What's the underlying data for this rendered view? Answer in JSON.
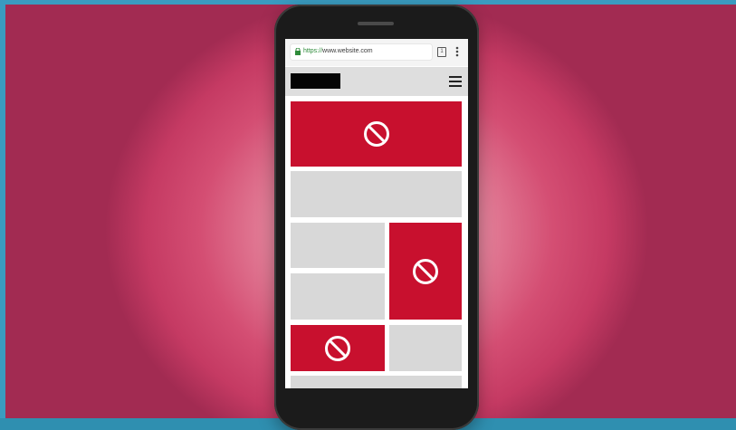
{
  "browser": {
    "url_protocol": "https://",
    "url_host": "www.website.com",
    "tab_count": "1"
  },
  "icons": {
    "lock": "lock-icon",
    "tabs": "tabs-icon",
    "menu": "more-vert-icon",
    "hamburger": "hamburger-menu-icon",
    "blocked": "block-icon"
  },
  "colors": {
    "ad_blocked": "#c8102e",
    "placeholder": "#d8d8d8",
    "background": "#d44e73"
  }
}
